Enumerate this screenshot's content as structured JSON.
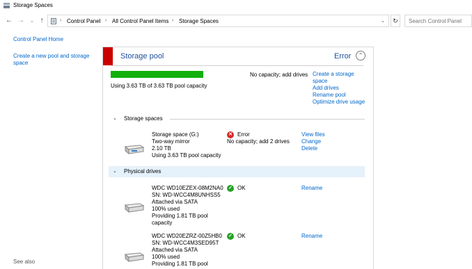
{
  "window": {
    "title": "Storage Spaces",
    "icon": "storage-spaces-icon"
  },
  "address": {
    "back": "←",
    "forward": "→",
    "dropdown": "⌄",
    "up": "↑",
    "refresh": "↻",
    "crumbs": [
      "Control Panel",
      "All Control Panel Items",
      "Storage Spaces"
    ],
    "separator": "›",
    "search_placeholder": "Search Control Panel"
  },
  "left_nav": {
    "home": "Control Panel Home",
    "create_line1": "Create a new pool and storage",
    "create_line2": "space",
    "see_also": "See also"
  },
  "pool": {
    "title": "Storage pool",
    "status": "Error",
    "status_color": "#cc0000",
    "collapse_glyph": "⌃",
    "usage_text": "Using 3.63 TB of 3.63 TB pool capacity",
    "usage_fraction": 1.0,
    "usage_color": "#11b00a",
    "capacity_warning": "No capacity; add drives",
    "links": {
      "create_line1": "Create a storage",
      "create_line2": "space",
      "add_drives": "Add drives",
      "rename_pool": "Rename pool",
      "optimize": "Optimize drive usage"
    }
  },
  "sections": {
    "storage_spaces": "Storage spaces",
    "physical_drives": "Physical drives",
    "chevron": "⌄"
  },
  "storage_space": {
    "name": "Storage space (G:)",
    "resiliency": "Two-way mirror",
    "size": "2.10 TB",
    "usage": "Using 3.63 TB pool capacity",
    "status": "Error",
    "status_glyph": "✕",
    "detail": "No capacity; add 2 drives",
    "links": {
      "view": "View files",
      "change": "Change",
      "delete": "Delete"
    }
  },
  "drives": [
    {
      "model": "WDC WD10EZEX-08M2NA0",
      "serial": "SN: WD-WCC4M8UNHSS5",
      "attached": "Attached via SATA",
      "used": "100% used",
      "providing_line1": "Providing 1.81 TB pool",
      "providing_line2": "capacity",
      "status": "OK",
      "status_glyph": "✓",
      "link": "Rename"
    },
    {
      "model": "WDC WD20EZRZ-00Z5HB0",
      "serial": "SN: WD-WCC4M3SED95T",
      "attached": "Attached via SATA",
      "used": "100% used",
      "providing_line1": "Providing 1.81 TB pool",
      "status": "OK",
      "status_glyph": "✓",
      "link": "Rename"
    }
  ]
}
